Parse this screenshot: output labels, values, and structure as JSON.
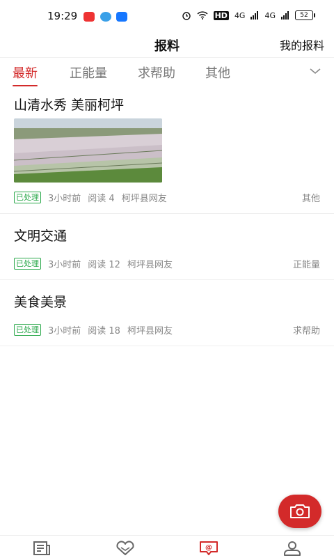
{
  "status_bar": {
    "time": "19:29",
    "signal_labels": [
      "HD",
      "4G",
      "4G"
    ],
    "battery": "52"
  },
  "header": {
    "title": "报料",
    "my_report": "我的报料"
  },
  "tabs": [
    {
      "label": "最新",
      "active": true
    },
    {
      "label": "正能量",
      "active": false
    },
    {
      "label": "求帮助",
      "active": false
    },
    {
      "label": "其他",
      "active": false
    }
  ],
  "posts": [
    {
      "title": "山清水秀 美丽柯坪",
      "has_image": true,
      "status": "已处理",
      "time": "3小时前",
      "reads": "阅读 4",
      "author": "柯坪县网友",
      "category": "其他"
    },
    {
      "title": "文明交通",
      "has_image": false,
      "status": "已处理",
      "time": "3小时前",
      "reads": "阅读 12",
      "author": "柯坪县网友",
      "category": "正能量"
    },
    {
      "title": "美食美景",
      "has_image": false,
      "status": "已处理",
      "time": "3小时前",
      "reads": "阅读 18",
      "author": "柯坪县网友",
      "category": "求帮助"
    }
  ],
  "fab": {
    "icon": "camera-icon"
  },
  "bottom_nav": [
    {
      "icon": "news-icon",
      "active": false
    },
    {
      "icon": "heart-icon",
      "active": false
    },
    {
      "icon": "report-chat-icon",
      "active": true
    },
    {
      "icon": "user-icon",
      "active": false
    }
  ],
  "colors": {
    "accent": "#d32a2a",
    "processed_badge": "#2aa84a",
    "meta_text": "#888888"
  }
}
